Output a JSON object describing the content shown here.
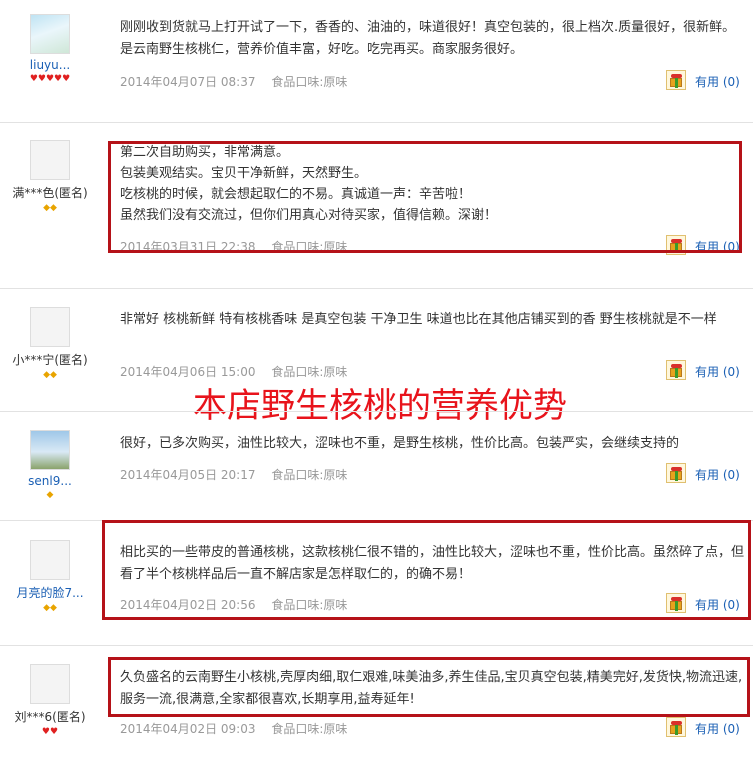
{
  "reviews": [
    {
      "user": "liuyu...",
      "level_icons": "♥♥♥♥♥",
      "text": "刚刚收到货就马上打开试了一下，香香的、油油的，味道很好！真空包装的，很上档次.质量很好，很新鲜。是云南野生核桃仁，营养价值丰富，好吃。吃完再买。商家服务很好。",
      "date": "2014年04月07日 08:37",
      "flavor": "食品口味:原味",
      "useful_label": "有用",
      "useful_count": "(0)"
    },
    {
      "user": "满***色(匿名)",
      "level_icons": "◆◆",
      "text": "第二次自助购买，非常满意。\n包装美观结实。宝贝干净新鲜，天然野生。\n吃核桃的时候，就会想起取仁的不易。真诚道一声：辛苦啦！\n虽然我们没有交流过，但你们用真心对待买家，值得信赖。深谢！",
      "date": "2014年03月31日 22:38",
      "flavor": "食品口味:原味",
      "useful_label": "有用",
      "useful_count": "(0)"
    },
    {
      "user": "小***宁(匿名)",
      "level_icons": "◆◆",
      "text": "非常好 核桃新鲜 特有核桃香味 是真空包装 干净卫生 味道也比在其他店铺买到的香 野生核桃就是不一样",
      "date": "2014年04月06日 15:00",
      "flavor": "食品口味:原味",
      "useful_label": "有用",
      "useful_count": "(0)"
    },
    {
      "user": "senl9...",
      "level_icons": "◆",
      "text": "很好，已多次购买，油性比较大，涩味也不重，是野生核桃，性价比高。包装严实，会继续支持的",
      "date": "2014年04月05日 20:17",
      "flavor": "食品口味:原味",
      "useful_label": "有用",
      "useful_count": "(0)"
    },
    {
      "user": "月亮的脸7...",
      "level_icons": "◆◆",
      "text": "相比买的一些带皮的普通核桃，这款核桃仁很不错的，油性比较大，涩味也不重，性价比高。虽然碎了点，但看了半个核桃样品后一直不解店家是怎样取仁的，的确不易！",
      "date": "2014年04月02日 20:56",
      "flavor": "食品口味:原味",
      "useful_label": "有用",
      "useful_count": "(0)"
    },
    {
      "user": "刘***6(匿名)",
      "level_icons": "♥♥",
      "text": "久负盛名的云南野生小核桃,壳厚肉细,取仁艰难,味美油多,养生佳品,宝贝真空包装,精美完好,发货快,物流迅速,服务一流,很满意,全家都很喜欢,长期享用,益寿延年!",
      "date": "2014年04月02日 09:03",
      "flavor": "食品口味:原味",
      "useful_label": "有用",
      "useful_count": "(0)"
    }
  ],
  "banner": "本店野生核桃的营养优势",
  "colors": {
    "link": "#1a5fb4",
    "highlight_border": "#b51218",
    "banner": "#e8131b",
    "meta": "#999999"
  }
}
